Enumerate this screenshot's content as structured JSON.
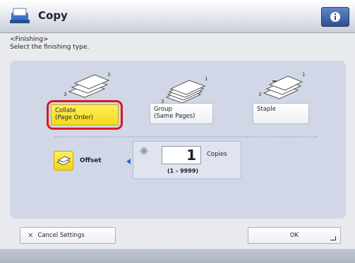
{
  "header": {
    "title": "Copy",
    "icon": "copy-app-icon",
    "info_icon": "info-icon"
  },
  "subtitle": {
    "line1": "<Finishing>",
    "line2": "Select the finishing type."
  },
  "options": [
    {
      "line1": "Collate",
      "line2": "(Page Order)",
      "selected": true,
      "icon": "collate-stack-icon"
    },
    {
      "line1": "Group",
      "line2": "(Same Pages)",
      "selected": false,
      "icon": "group-stack-icon"
    },
    {
      "line1": "Staple",
      "line2": "",
      "selected": false,
      "icon": "staple-stack-icon"
    }
  ],
  "offset": {
    "label": "Offset",
    "checked": true
  },
  "copies": {
    "value": "1",
    "unit": "Copies",
    "range": "(1 - 9999)"
  },
  "footer": {
    "cancel_label": "Cancel Settings",
    "ok_label": "OK"
  },
  "colors": {
    "selected": "#f5d81c",
    "highlight_ring": "#d31a24",
    "panel": "#d1d7e6",
    "accent_blue": "#2e69c8"
  }
}
